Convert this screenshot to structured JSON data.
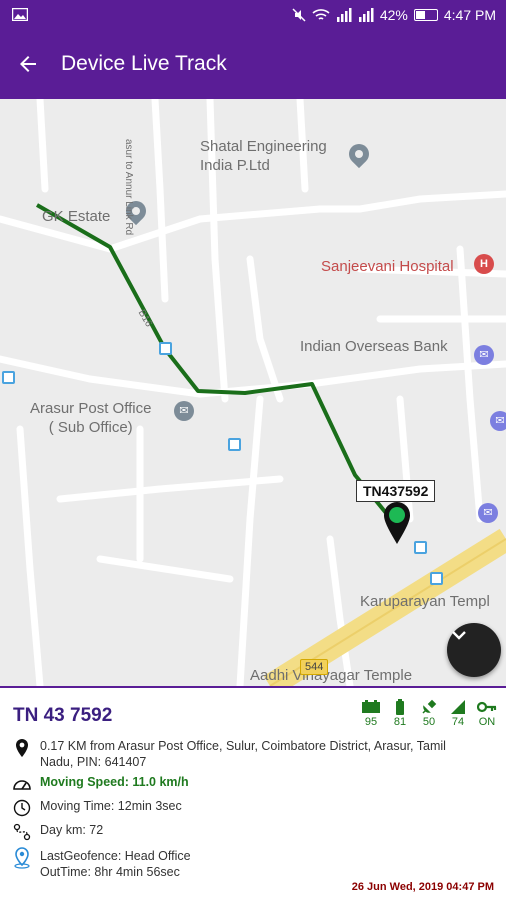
{
  "status_bar": {
    "battery": "42%",
    "time": "4:47 PM"
  },
  "app_bar": {
    "title": "Device Live Track"
  },
  "map": {
    "labels": {
      "shatal": "Shatal Engineering\nIndia P.Ltd",
      "gk_estate": "GK Estate",
      "sanjeevani": "Sanjeevani Hospital",
      "iob": "Indian Overseas Bank",
      "arasur_po": "Arasur Post Office\n( Sub Office)",
      "karuparayan": "Karuparayan Templ",
      "aadhi": "Aadhi Vinayagar Temple",
      "road_annur": "asur to Annur Link Rd",
      "road_b": "B16",
      "route_544": "544"
    },
    "vehicle_marker": "TN437592"
  },
  "panel": {
    "vehicle_number": "TN 43 7592",
    "stats": [
      {
        "icon": "battery-icon",
        "value": "95"
      },
      {
        "icon": "power-bar-icon",
        "value": "81"
      },
      {
        "icon": "satellite-icon",
        "value": "50"
      },
      {
        "icon": "signal-icon",
        "value": "74"
      },
      {
        "icon": "key-icon",
        "value": "ON"
      }
    ],
    "address": "0.17 KM from Arasur Post Office, Sulur, Coimbatore District, Arasur, Tamil Nadu, PIN: 641407",
    "moving_speed": "Moving Speed: 11.0 km/h",
    "moving_time": "Moving Time: 12min 3sec",
    "day_km": "Day km: 72",
    "geofence": "LastGeofence: Head Office",
    "out_time": "OutTime: 8hr 4min 56sec",
    "timestamp": "26 Jun Wed, 2019 04:47 PM"
  },
  "colors": {
    "primary": "#5a1d96",
    "route": "#1a6e1a",
    "accent_green": "#1f7a1f",
    "timestamp": "#8b0000"
  }
}
